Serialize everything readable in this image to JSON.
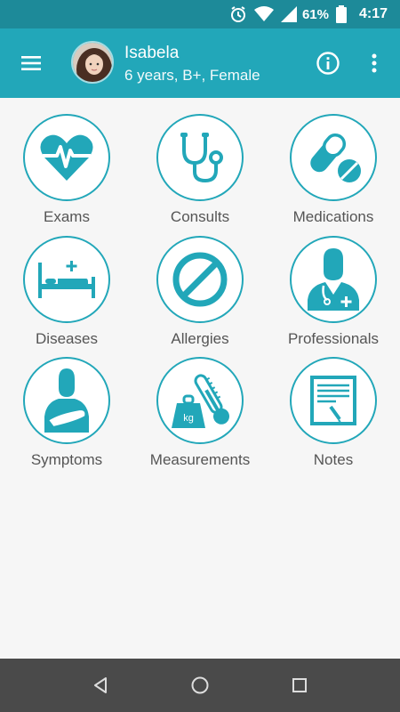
{
  "status_bar": {
    "battery": "61%",
    "time": "4:17",
    "icons": [
      "alarm-icon",
      "wifi-icon",
      "signal-icon",
      "battery-icon"
    ]
  },
  "app_bar": {
    "name": "Isabela",
    "details": "6 years, B+, Female",
    "icons": [
      "menu-icon",
      "avatar",
      "info-icon",
      "more-vert-icon"
    ]
  },
  "menu": {
    "items": [
      {
        "label": "Exams",
        "icon": "heart-pulse-icon"
      },
      {
        "label": "Consults",
        "icon": "stethoscope-icon"
      },
      {
        "label": "Medications",
        "icon": "pills-icon"
      },
      {
        "label": "Diseases",
        "icon": "hospital-bed-icon"
      },
      {
        "label": "Allergies",
        "icon": "prohibited-icon"
      },
      {
        "label": "Professionals",
        "icon": "doctor-icon"
      },
      {
        "label": "Symptoms",
        "icon": "injured-person-icon"
      },
      {
        "label": "Measurements",
        "icon": "weight-thermometer-icon"
      },
      {
        "label": "Notes",
        "icon": "notepad-icon"
      }
    ]
  },
  "colors": {
    "status_bar": "#1d8a99",
    "app_bar": "#22a7b9",
    "accent": "#22a7b9",
    "label_text": "#555555",
    "background": "#f6f6f6",
    "nav_bar": "#4a4a4a"
  },
  "nav_bar": {
    "icons": [
      "back-icon",
      "home-icon",
      "recents-icon"
    ]
  }
}
